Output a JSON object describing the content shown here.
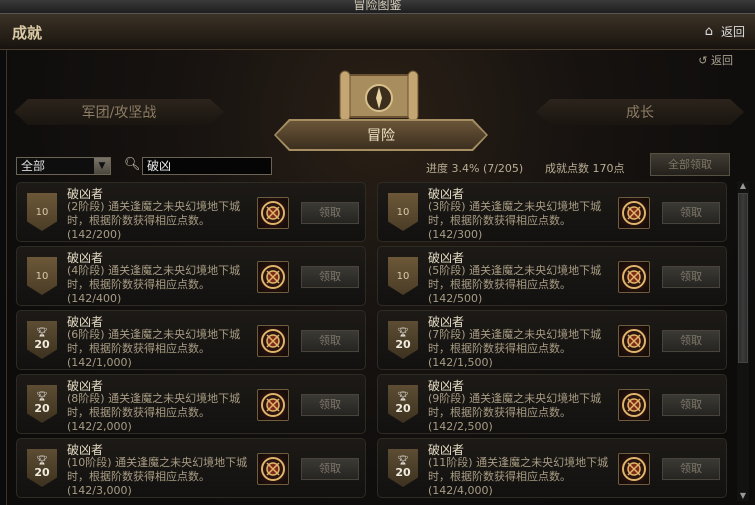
{
  "window": {
    "title": "冒险图鉴"
  },
  "header": {
    "title": "成就",
    "back_label": "返回"
  },
  "panel": {
    "back_label": "返回"
  },
  "categories": {
    "left": "军团/攻坚战",
    "center": "冒险",
    "right": "成长"
  },
  "filter": {
    "selected": "全部"
  },
  "search": {
    "value": "破凶"
  },
  "stats": {
    "progress": "进度  3.4% (7/205)",
    "points": "成就点数 170点"
  },
  "claim_all_label": "全部领取",
  "achievements": [
    {
      "badge": "10",
      "badge_type": "bronze",
      "name": "破凶者",
      "desc": "(2阶段) 通关逢魔之未央幻境地下城时，根据阶数获得相应点数。",
      "progress": "(142/200)",
      "claim": "领取"
    },
    {
      "badge": "10",
      "badge_type": "bronze",
      "name": "破凶者",
      "desc": "(3阶段) 通关逢魔之未央幻境地下城时，根据阶数获得相应点数。",
      "progress": "(142/300)",
      "claim": "领取"
    },
    {
      "badge": "10",
      "badge_type": "bronze",
      "name": "破凶者",
      "desc": "(4阶段) 通关逢魔之未央幻境地下城时，根据阶数获得相应点数。",
      "progress": "(142/400)",
      "claim": "领取"
    },
    {
      "badge": "10",
      "badge_type": "bronze",
      "name": "破凶者",
      "desc": "(5阶段) 通关逢魔之未央幻境地下城时，根据阶数获得相应点数。",
      "progress": "(142/500)",
      "claim": "领取"
    },
    {
      "badge": "20",
      "badge_type": "silver",
      "name": "破凶者",
      "desc": "(6阶段) 通关逢魔之未央幻境地下城时，根据阶数获得相应点数。",
      "progress": "(142/1,000)",
      "claim": "领取"
    },
    {
      "badge": "20",
      "badge_type": "silver",
      "name": "破凶者",
      "desc": "(7阶段) 通关逢魔之未央幻境地下城时，根据阶数获得相应点数。",
      "progress": "(142/1,500)",
      "claim": "领取"
    },
    {
      "badge": "20",
      "badge_type": "silver",
      "name": "破凶者",
      "desc": "(8阶段) 通关逢魔之未央幻境地下城时，根据阶数获得相应点数。",
      "progress": "(142/2,000)",
      "claim": "领取"
    },
    {
      "badge": "20",
      "badge_type": "silver",
      "name": "破凶者",
      "desc": "(9阶段) 通关逢魔之未央幻境地下城时，根据阶数获得相应点数。",
      "progress": "(142/2,500)",
      "claim": "领取"
    },
    {
      "badge": "20",
      "badge_type": "silver",
      "name": "破凶者",
      "desc": "(10阶段) 通关逢魔之未央幻境地下城时，根据阶数获得相应点数。",
      "progress": "(142/3,000)",
      "claim": "领取"
    },
    {
      "badge": "20",
      "badge_type": "silver",
      "name": "破凶者",
      "desc": "(11阶段) 通关逢魔之未央幻境地下城时，根据阶数获得相应点数。",
      "progress": "(142/4,000)",
      "claim": "领取"
    }
  ],
  "icons": {
    "home": "home-icon",
    "back": "return-arrow-icon",
    "search": "search-icon",
    "trophy": "trophy-icon",
    "reward": "reward-emblem-icon",
    "scroll": "scroll-compass-icon"
  },
  "colors": {
    "accent": "#a58e62",
    "text": "#c9bfa6"
  }
}
